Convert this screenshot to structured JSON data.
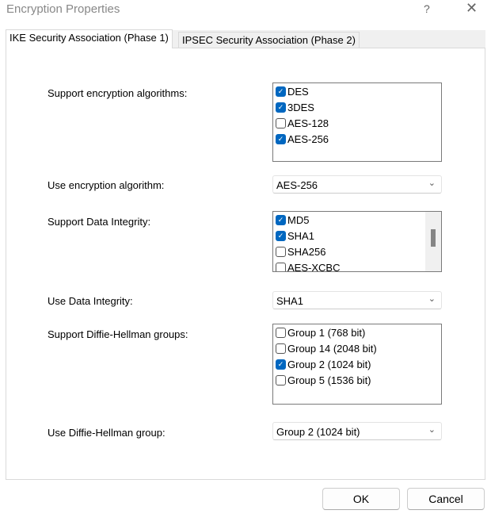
{
  "window": {
    "title": "Encryption Properties",
    "help": "?",
    "close": "✕"
  },
  "tabs": [
    {
      "label": "IKE Security Association (Phase 1)"
    },
    {
      "label": "IPSEC Security Association (Phase 2)"
    }
  ],
  "enc": {
    "label": "Support encryption algorithms:",
    "items": [
      {
        "label": "DES",
        "checked": true
      },
      {
        "label": "3DES",
        "checked": true
      },
      {
        "label": "AES-128",
        "checked": false
      },
      {
        "label": "AES-256",
        "checked": true
      }
    ],
    "use_label": "Use encryption algorithm:",
    "use_value": "AES-256"
  },
  "integ": {
    "label": "Support Data Integrity:",
    "items": [
      {
        "label": "MD5",
        "checked": true
      },
      {
        "label": "SHA1",
        "checked": true
      },
      {
        "label": "SHA256",
        "checked": false
      },
      {
        "label": "AES-XCBC",
        "checked": false
      }
    ],
    "use_label": "Use Data Integrity:",
    "use_value": "SHA1"
  },
  "dh": {
    "label": "Support Diffie-Hellman groups:",
    "items": [
      {
        "label": "Group 1 (768 bit)",
        "checked": false
      },
      {
        "label": "Group 14 (2048 bit)",
        "checked": false
      },
      {
        "label": "Group 2 (1024 bit)",
        "checked": true
      },
      {
        "label": "Group 5 (1536 bit)",
        "checked": false
      }
    ],
    "use_label": "Use Diffie-Hellman group:",
    "use_value": "Group 2 (1024 bit)"
  },
  "buttons": {
    "ok": "OK",
    "cancel": "Cancel"
  },
  "colors": {
    "accent": "#0067c0"
  }
}
